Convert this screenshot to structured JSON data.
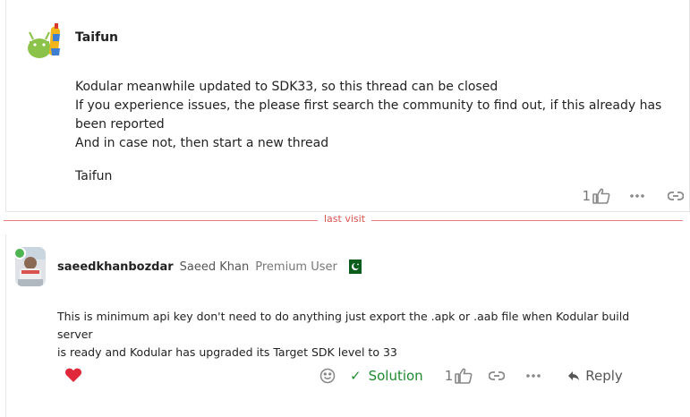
{
  "post1": {
    "username": "Taifun",
    "lines": [
      "Kodular meanwhile updated to SDK33, so this thread can be closed",
      "If you experience issues, the please first search the community to find out, if this already has been reported",
      "And in case not, then start a new thread"
    ],
    "signature": "Taifun",
    "like_count": "1"
  },
  "divider": {
    "label": "last visit"
  },
  "post2": {
    "username": "saeedkhanbozdar",
    "full_name": "Saeed Khan",
    "user_title": "Premium User",
    "lines": [
      "This is minimum api key don't need to do anything just export the .apk or .aab file when Kodular build server",
      "is ready and Kodular has upgraded its Target SDK level to 33"
    ],
    "solution_label": "Solution",
    "like_count": "1",
    "reply_label": "Reply"
  },
  "colors": {
    "accent_green": "#1e8a2e",
    "heart_red": "#e0283a",
    "divider_red": "#e87e7e"
  }
}
